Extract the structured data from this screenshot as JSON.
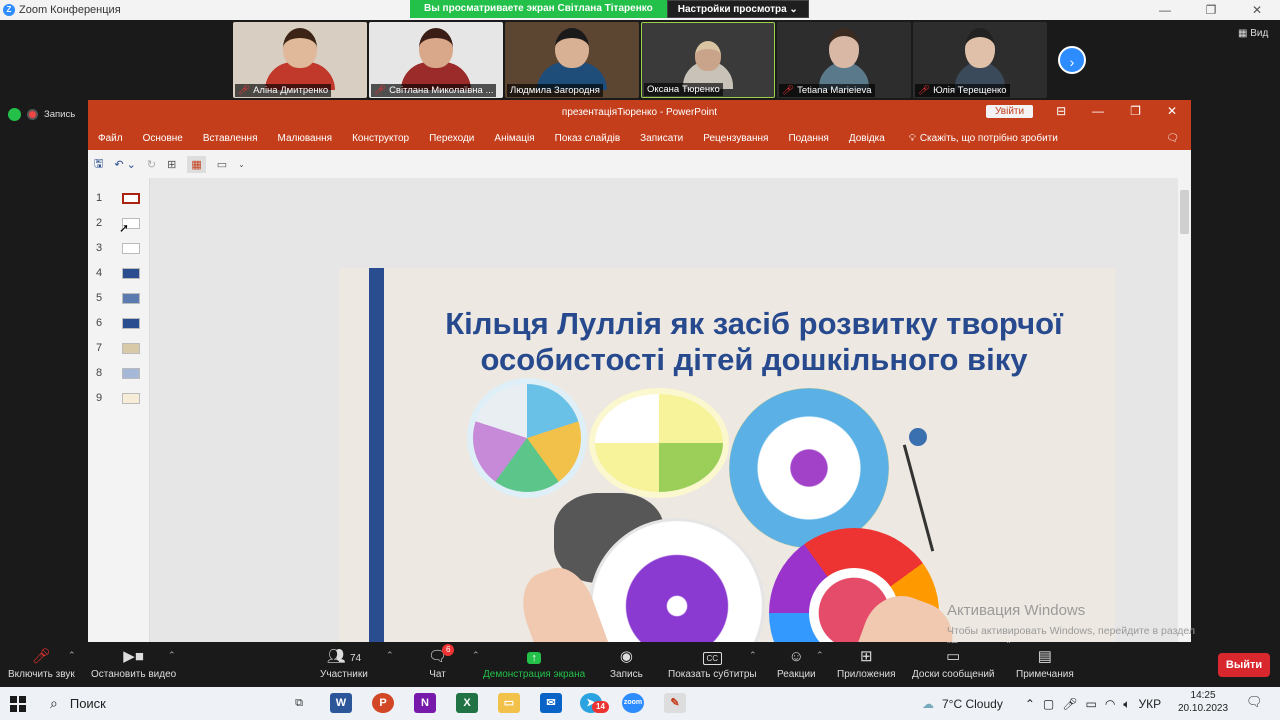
{
  "window": {
    "title": "Zoom Конференция"
  },
  "share_banner": {
    "text": "Вы просматриваете экран Світлана Тітаренко",
    "view_options": "Настройки просмотра"
  },
  "participants": [
    {
      "name": "Аліна Дмитренко",
      "muted": true
    },
    {
      "name": "Світлана Миколаївна ...",
      "muted": true
    },
    {
      "name": "Людмила Загородня",
      "muted": false
    },
    {
      "name": "Оксана Тюренко",
      "muted": false
    },
    {
      "name": "Tetiana Marieieva",
      "muted": true
    },
    {
      "name": "Юлія Терещенко",
      "muted": true
    }
  ],
  "view_button": "Вид",
  "recording": {
    "label": "Запись"
  },
  "powerpoint": {
    "title": "презентаціяТюренко - PowerPoint",
    "signin": "Увійти",
    "tabs": [
      "Файл",
      "Основне",
      "Вставлення",
      "Малювання",
      "Конструктор",
      "Переходи",
      "Анімація",
      "Показ слайдів",
      "Записати",
      "Рецензування",
      "Подання",
      "Довідка"
    ],
    "tell_me": "Скажіть, що потрібно зробити",
    "slide_numbers": [
      "1",
      "2",
      "3",
      "4",
      "5",
      "6",
      "7",
      "8",
      "9"
    ],
    "slide_title": "Кільця Луллія як засіб розвитку творчої особистості дітей дошкільного віку"
  },
  "activation": {
    "title": "Активация Windows",
    "text": "Чтобы активировать Windows, перейдите в раздел \"Параметры\"."
  },
  "toolbar": {
    "mute": "Включить звук",
    "video": "Остановить видео",
    "participants": "Участники",
    "participants_count": "74",
    "chat": "Чат",
    "chat_badge": "6",
    "share": "Демонстрация экрана",
    "record": "Запись",
    "captions": "Показать субтитры",
    "reactions": "Реакции",
    "apps": "Приложения",
    "whiteboards": "Доски сообщений",
    "notes": "Примечания",
    "leave": "Выйти"
  },
  "taskbar": {
    "search": "Поиск",
    "weather": "7°C  Cloudy",
    "lang": "УКР",
    "time": "14:25",
    "date": "20.10.2023",
    "telegram_badge": "14"
  },
  "colors": {
    "ppt_accent": "#c43e1c",
    "zoom_blue": "#2d8cff",
    "share_green": "#23c04a",
    "slide_title": "#27498e",
    "leave_red": "#d9272e"
  }
}
